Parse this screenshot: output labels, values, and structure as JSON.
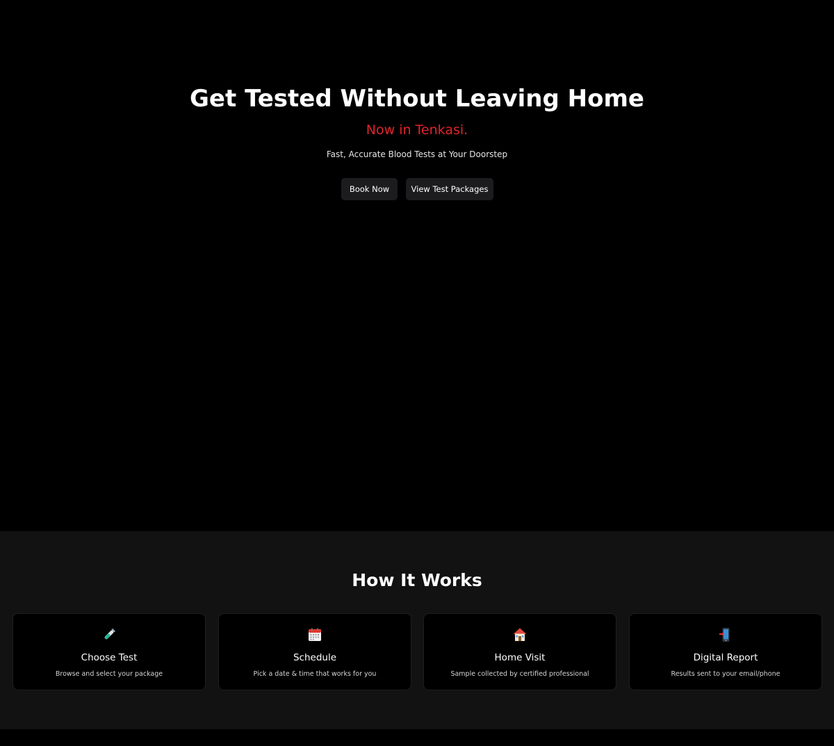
{
  "hero": {
    "title": "Get Tested Without Leaving Home",
    "tagline": "Now in Tenkasi.",
    "subtitle": "Fast, Accurate Blood Tests at Your Doorstep",
    "buttons": {
      "book": "Book Now",
      "packages": "View Test Packages"
    }
  },
  "how_it_works": {
    "title": "How It Works",
    "steps": [
      {
        "icon": "test-tube-icon",
        "title": "Choose Test",
        "description": "Browse and select your package"
      },
      {
        "icon": "calendar-icon",
        "title": "Schedule",
        "description": "Pick a date & time that works for you"
      },
      {
        "icon": "house-icon",
        "title": "Home Visit",
        "description": "Sample collected by certified professional"
      },
      {
        "icon": "mobile-phone-icon",
        "title": "Digital Report",
        "description": "Results sent to your email/phone"
      }
    ]
  },
  "colors": {
    "background": "#000000",
    "section_background": "#121212",
    "accent": "#e0242a",
    "button_background": "#1c1c1e"
  }
}
